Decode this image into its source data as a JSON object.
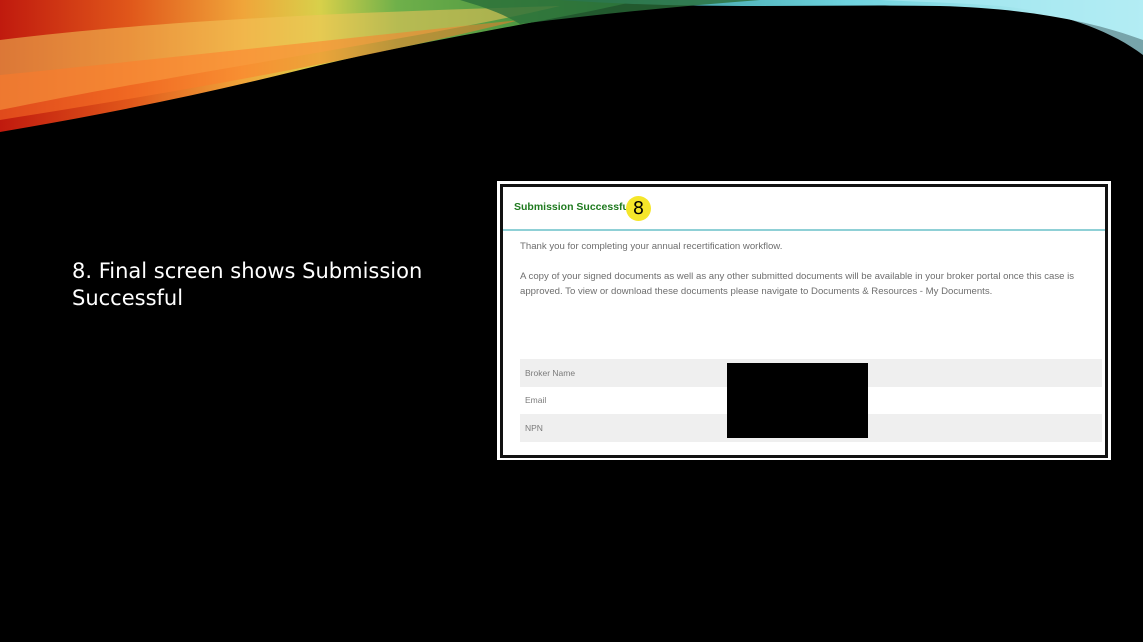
{
  "slide": {
    "caption": "8.  Final screen shows Submission Successful"
  },
  "screenshot": {
    "title": "Submission Successful!",
    "step_number": "8",
    "paragraph_1": "Thank you for completing your annual recertification workflow.",
    "paragraph_2": "A copy of your signed documents as well as any other submitted documents will be available in your broker portal once this case is approved. To view or download these documents please navigate to Documents & Resources - My Documents.",
    "rows": [
      {
        "label": "Broker Name"
      },
      {
        "label": "Email"
      },
      {
        "label": "NPN"
      }
    ]
  },
  "colors": {
    "title_green": "#1f7a1f",
    "badge_yellow": "#f5e62a",
    "header_rule": "#8fd0d6"
  }
}
